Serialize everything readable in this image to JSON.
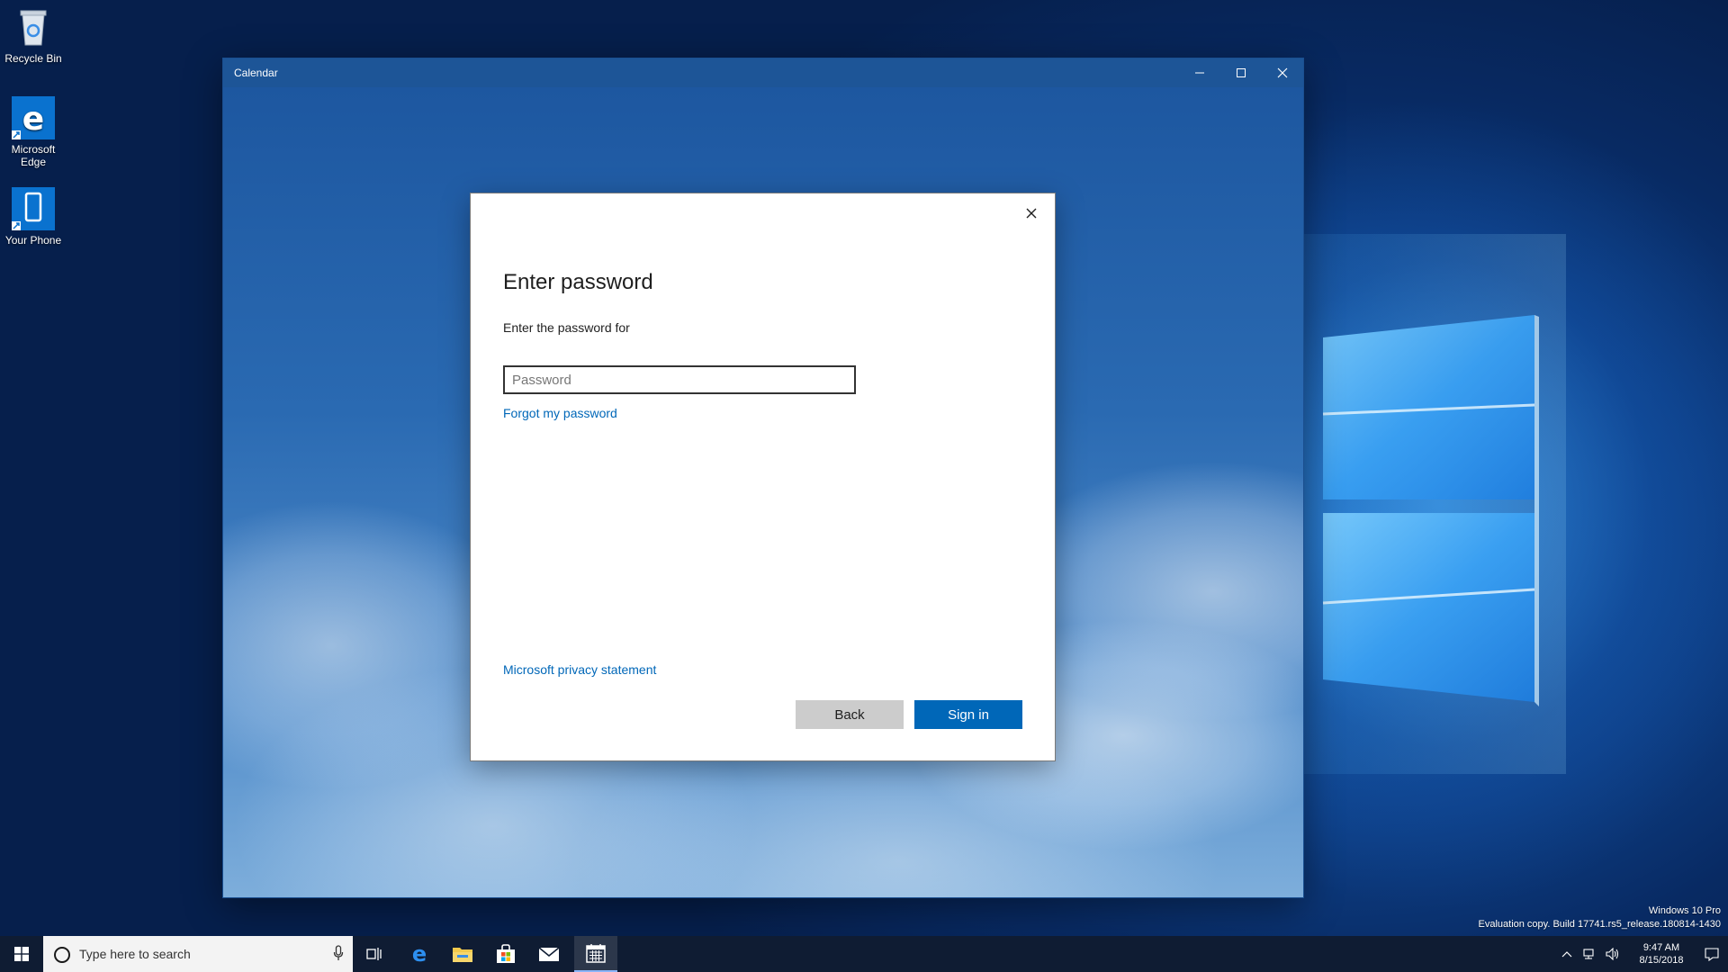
{
  "desktop": {
    "icons": [
      {
        "label": "Recycle Bin",
        "icon": "recycle-bin-icon"
      },
      {
        "label": "Microsoft Edge",
        "icon": "edge-icon"
      },
      {
        "label": "Your Phone",
        "icon": "phone-icon"
      }
    ]
  },
  "window": {
    "title": "Calendar",
    "controls": [
      "minimize-icon",
      "maximize-icon",
      "close-icon"
    ]
  },
  "dialog": {
    "heading": "Enter password",
    "subtext": "Enter the password for",
    "password_placeholder": "Password",
    "password_value": "",
    "forgot_link": "Forgot my password",
    "privacy_link": "Microsoft privacy statement",
    "back_label": "Back",
    "signin_label": "Sign in"
  },
  "watermark": {
    "edition": "Windows 10 Pro",
    "build": "Evaluation copy. Build 17741.rs5_release.180814-1430"
  },
  "taskbar": {
    "search_placeholder": "Type here to search",
    "apps": [
      "task-view-icon",
      "edge-icon",
      "file-explorer-icon",
      "store-icon",
      "mail-icon",
      "calendar-icon"
    ],
    "active_app": "calendar-icon",
    "time": "9:47 AM",
    "date": "8/15/2018"
  },
  "colors": {
    "accent": "#0067b8",
    "titlebar": "#1d5597",
    "taskbar": "#0f1c33"
  }
}
